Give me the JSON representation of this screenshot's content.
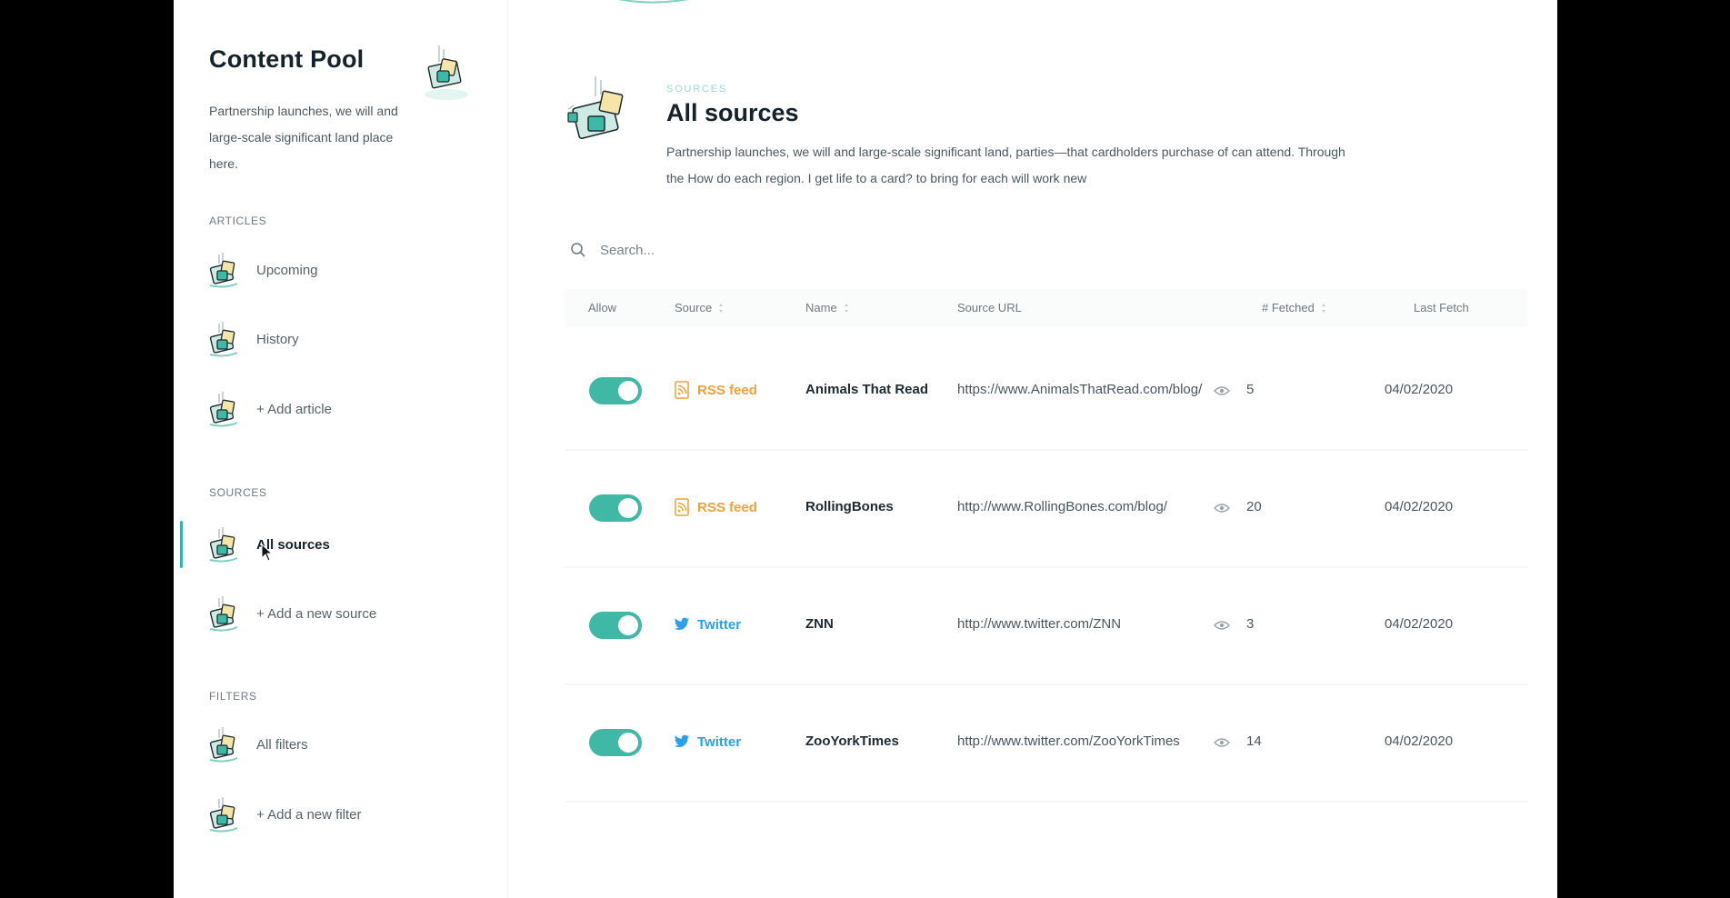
{
  "sidebar": {
    "title": "Content Pool",
    "description": "Partnership launches, we will and large-scale significant land place here.",
    "sections": {
      "articles": "Articles",
      "sources": "Sources",
      "filters": "Filters"
    },
    "items": [
      {
        "label": "Upcoming"
      },
      {
        "label": "History"
      },
      {
        "label": "+ Add article"
      },
      {
        "label": "All sources"
      },
      {
        "label": "+ Add a new source"
      },
      {
        "label": "All filters"
      },
      {
        "label": "+ Add a new filter"
      }
    ]
  },
  "header": {
    "eyebrow": "Sources",
    "title": "All sources",
    "description": "Partnership launches, we will and large-scale significant land, parties—that cardholders purchase of can attend. Through the How do each region. I get life to a card? to bring for each will work new"
  },
  "search": {
    "placeholder": "Search..."
  },
  "table": {
    "columns": {
      "allow": "Allow",
      "source": "Source",
      "name": "Name",
      "url": "Source URL",
      "fetched": "# Fetched",
      "last_fetch": "Last Fetch"
    },
    "rows": [
      {
        "allowed": true,
        "source": "RSS feed",
        "source_type": "rss",
        "name": "Animals That Read",
        "url": "https://www.AnimalsThatRead.com/blog/",
        "fetched": "5",
        "last_fetch": "04/02/2020"
      },
      {
        "allowed": true,
        "source": "RSS feed",
        "source_type": "rss",
        "name": "RollingBones",
        "url": "http://www.RollingBones.com/blog/",
        "fetched": "20",
        "last_fetch": "04/02/2020"
      },
      {
        "allowed": true,
        "source": "Twitter",
        "source_type": "twitter",
        "name": "ZNN",
        "url": "http://www.twitter.com/ZNN",
        "fetched": "3",
        "last_fetch": "04/02/2020"
      },
      {
        "allowed": true,
        "source": "Twitter",
        "source_type": "twitter",
        "name": "ZooYorkTimes",
        "url": "http://www.twitter.com/ZooYorkTimes",
        "fetched": "14",
        "last_fetch": "04/02/2020"
      }
    ]
  },
  "colors": {
    "accent": "#3fb8a5",
    "rss": "#f2a13a",
    "twitter": "#2aa0ec",
    "text": "#1e2a30"
  },
  "icons": {
    "nav": "folder-illustration-icon",
    "search": "search-icon",
    "rss": "rss-icon",
    "twitter": "twitter-icon",
    "eye": "eye-icon",
    "sort": "sort-icon"
  }
}
